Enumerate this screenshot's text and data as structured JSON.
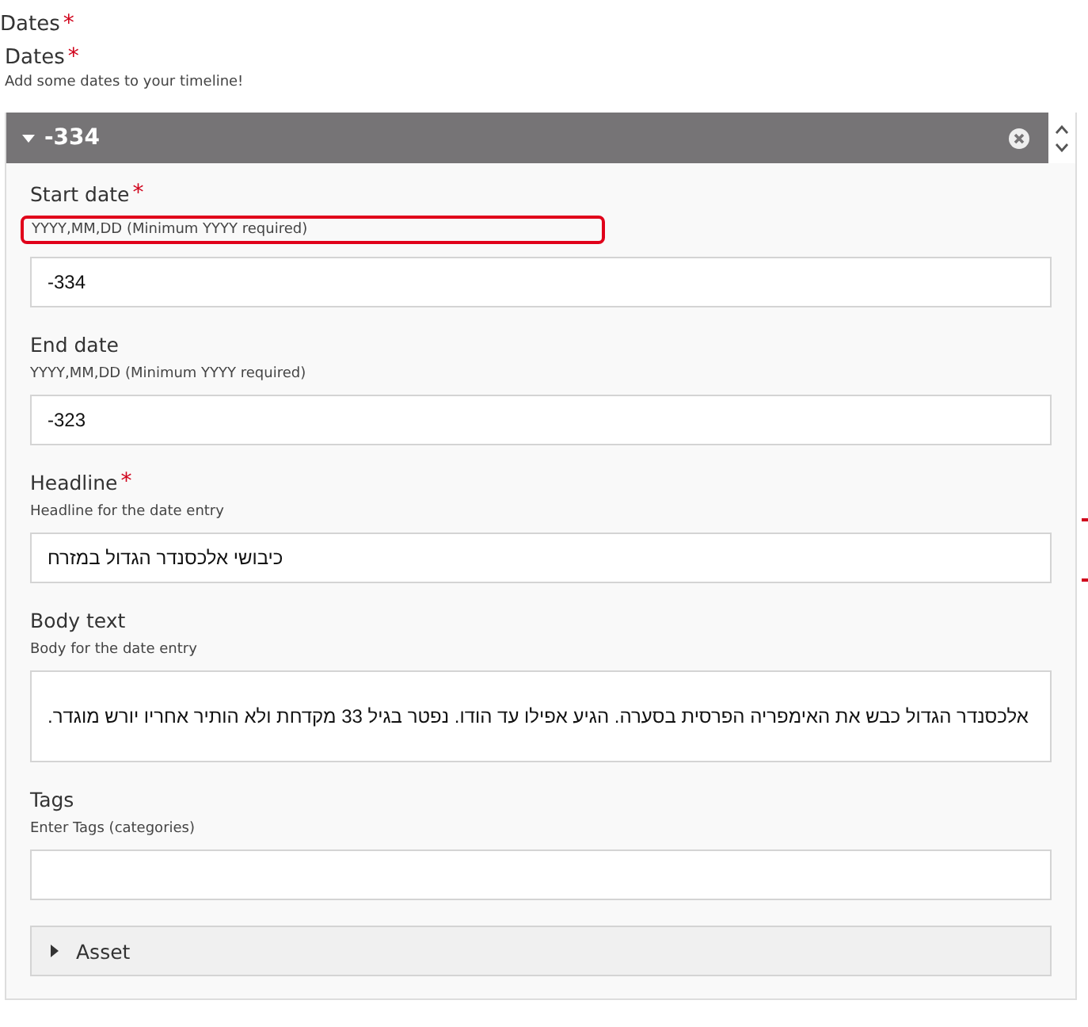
{
  "section_title": "Dates",
  "section_required_mark": "*",
  "group": {
    "title": "Dates",
    "required_mark": "*",
    "description": "Add some dates to your timeline!"
  },
  "entry": {
    "title": "-334",
    "expanded": true,
    "fields": [
      {
        "kind": "input",
        "label": "Start date",
        "required_mark": "*",
        "description": "YYYY,MM,DD (Minimum YYYY required)",
        "highlighted": true,
        "value": "-334"
      },
      {
        "kind": "input",
        "label": "End date",
        "description": "YYYY,MM,DD (Minimum YYYY required)",
        "highlighted": false,
        "value": "-323"
      },
      {
        "kind": "input",
        "label": "Headline",
        "required_mark": "*",
        "description": "Headline for the date entry",
        "highlighted": false,
        "value": "כיבושי אלכסנדר הגדול במזרח",
        "flagged": true
      },
      {
        "kind": "textarea",
        "label": "Body text",
        "description": "Body for the date entry",
        "highlighted": false,
        "value": "אלכסנדר הגדול כבש את האימפריה הפרסית בסערה. הגיע אפילו עד הודו. נפטר בגיל 33 מקדחת ולא הותיר אחריו יורש מוגדר."
      },
      {
        "kind": "input",
        "label": "Tags",
        "description": "Enter Tags (categories)",
        "highlighted": false
      },
      {
        "kind": "collapsible",
        "label": "Asset",
        "expanded": false
      }
    ]
  }
}
